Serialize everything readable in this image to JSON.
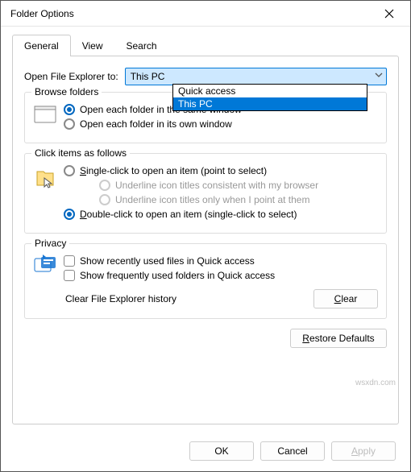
{
  "window": {
    "title": "Folder Options"
  },
  "tabs": {
    "general": "General",
    "view": "View",
    "search": "Search"
  },
  "openExplorer": {
    "label": "Open File Explorer to:",
    "value": "This PC",
    "options": [
      "Quick access",
      "This PC"
    ],
    "selected_index": 1
  },
  "browse": {
    "legend": "Browse folders",
    "same": "Open each folder in the same window",
    "own": "Open each folder in its own window"
  },
  "click": {
    "legend": "Click items as follows",
    "single": "Single-click to open an item (point to select)",
    "underline_browser": "Underline icon titles consistent with my browser",
    "underline_point": "Underline icon titles only when I point at them",
    "double": "Double-click to open an item (single-click to select)"
  },
  "privacy": {
    "legend": "Privacy",
    "recent_files": "Show recently used files in Quick access",
    "freq_folders": "Show frequently used folders in Quick access",
    "clear_label": "Clear File Explorer history",
    "clear_btn": "Clear"
  },
  "restore": "Restore Defaults",
  "buttons": {
    "ok": "OK",
    "cancel": "Cancel",
    "apply": "Apply"
  },
  "watermark": "wsxdn.com"
}
